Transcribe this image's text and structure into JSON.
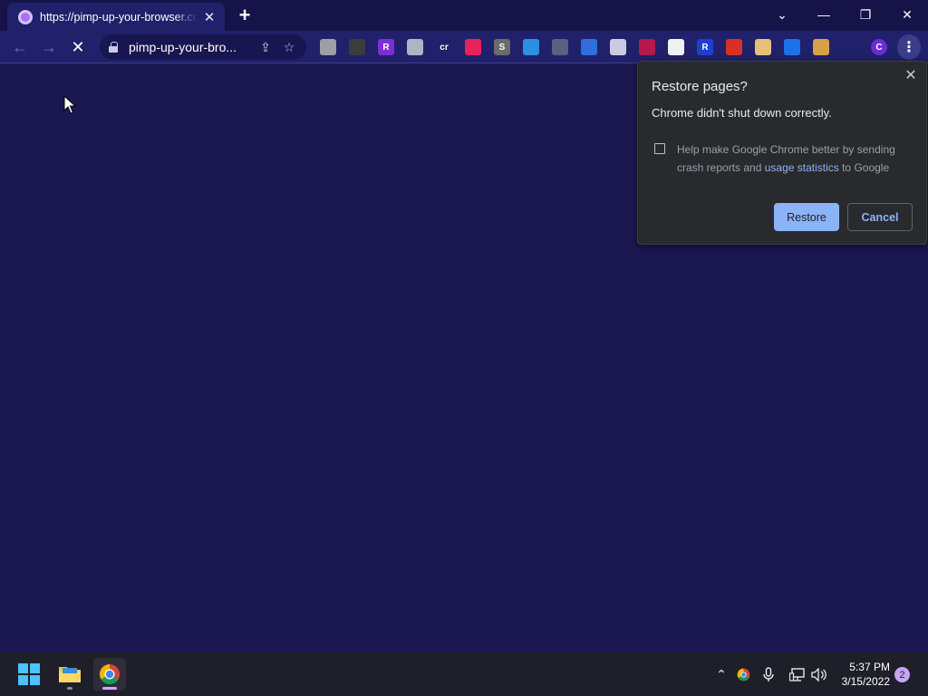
{
  "tab": {
    "title": "https://pimp-up-your-browser.com",
    "close_glyph": "✕"
  },
  "newtab_glyph": "+",
  "window_controls": {
    "tabsearch_glyph": "⌄",
    "minimize_glyph": "—",
    "restore_glyph": "❐",
    "close_glyph": "✕"
  },
  "toolbar": {
    "back_glyph": "←",
    "forward_glyph": "→",
    "reload_glyph": "✕",
    "url": "pimp-up-your-bro...",
    "share_glyph": "⇪",
    "bookmark_glyph": "☆",
    "menu_glyph": "⋮"
  },
  "extensions": [
    {
      "icon": "rounded-square-extension-icon",
      "label": "",
      "color": "#9aa0a6"
    },
    {
      "icon": "dark-leaf-extension-icon",
      "label": "",
      "color": "#3c3c3c"
    },
    {
      "icon": "r-letter-extension-icon",
      "label": "R",
      "color": "#7b2fd4"
    },
    {
      "icon": "cloud-extension-icon",
      "label": "",
      "color": "#b0b4c0"
    },
    {
      "icon": "cr-extension-icon",
      "label": "cr",
      "color": "#20216a"
    },
    {
      "icon": "cursor-extension-icon",
      "label": "",
      "color": "#e5245b"
    },
    {
      "icon": "s-extension-icon",
      "label": "S",
      "color": "#6b6b6b"
    },
    {
      "icon": "edge-extension-icon",
      "label": "",
      "color": "#2b8fe3"
    },
    {
      "icon": "paw-extension-icon",
      "label": "",
      "color": "#5c5f7e"
    },
    {
      "icon": "grid-extension-icon",
      "label": "",
      "color": "#2f6de0"
    },
    {
      "icon": "circle-extension-icon",
      "label": "",
      "color": "#c9cbe0"
    },
    {
      "icon": "crimson-extension-icon",
      "label": "",
      "color": "#b5194b"
    },
    {
      "icon": "diamond-extension-icon",
      "label": "",
      "color": "#f1f1f1"
    },
    {
      "icon": "r-blue-extension-icon",
      "label": "R",
      "color": "#1e3fd6"
    },
    {
      "icon": "video-extension-icon",
      "label": "",
      "color": "#d93025"
    },
    {
      "icon": "pig-extension-icon",
      "label": "",
      "color": "#e6c07b"
    },
    {
      "icon": "play-extension-icon",
      "label": "",
      "color": "#1a73e8"
    },
    {
      "icon": "monkey-extension-icon",
      "label": "",
      "color": "#d9a04a"
    },
    {
      "icon": "puzzle-extension-icon",
      "label": "",
      "color": "#20216a"
    },
    {
      "icon": "profile-avatar-icon",
      "label": "C",
      "color": "#6c2bd9"
    }
  ],
  "dialog": {
    "title": "Restore pages?",
    "message": "Chrome didn't shut down correctly.",
    "checkbox_text_1": "Help make Google Chrome better by sending crash reports and ",
    "checkbox_link": "usage statistics",
    "checkbox_text_2": " to Google",
    "restore_label": "Restore",
    "cancel_label": "Cancel",
    "close_glyph": "✕"
  },
  "taskbar": {
    "time": "5:37 PM",
    "date": "3/15/2022",
    "notification_count": "2",
    "chevron_glyph": "⌃"
  }
}
